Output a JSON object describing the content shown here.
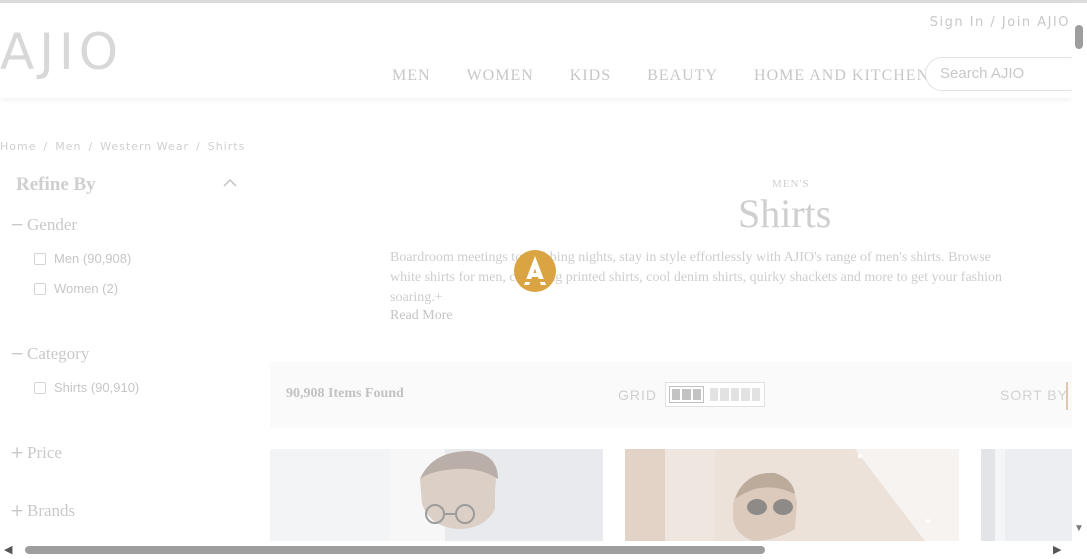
{
  "header": {
    "logo": "AJIO",
    "signin": "Sign In / Join AJIO",
    "nav": [
      "MEN",
      "WOMEN",
      "KIDS",
      "BEAUTY",
      "HOME AND KITCHEN"
    ],
    "search_placeholder": "Search AJIO"
  },
  "breadcrumb": [
    "Home",
    "Men",
    "Western Wear",
    "Shirts"
  ],
  "sidebar": {
    "title": "Refine By",
    "facets": [
      {
        "symbol": "−",
        "label": "Gender",
        "options": [
          "Men (90,908)",
          "Women (2)"
        ]
      },
      {
        "symbol": "−",
        "label": "Category",
        "options": [
          "Shirts (90,910)"
        ]
      },
      {
        "symbol": "+",
        "label": "Price"
      },
      {
        "symbol": "+",
        "label": "Brands"
      }
    ]
  },
  "main": {
    "kicker": "MEN'S",
    "title": "Shirts",
    "description_lines": [
      "Boardroom meetings to clubbing nights, stay in style effortlessly with AJIO's range of men's shirts. Browse",
      "white shirts for men, charming printed shirts, cool denim shirts, quirky shackets and more to get your fashion",
      "soaring.+"
    ],
    "read_more": "Read More"
  },
  "toolbar": {
    "items_found": "90,908 Items Found",
    "grid_label": "GRID",
    "sort_label": "SORT BY"
  },
  "colors": {
    "loader": "#d9a441",
    "accent_sort": "#e2c8a8"
  }
}
